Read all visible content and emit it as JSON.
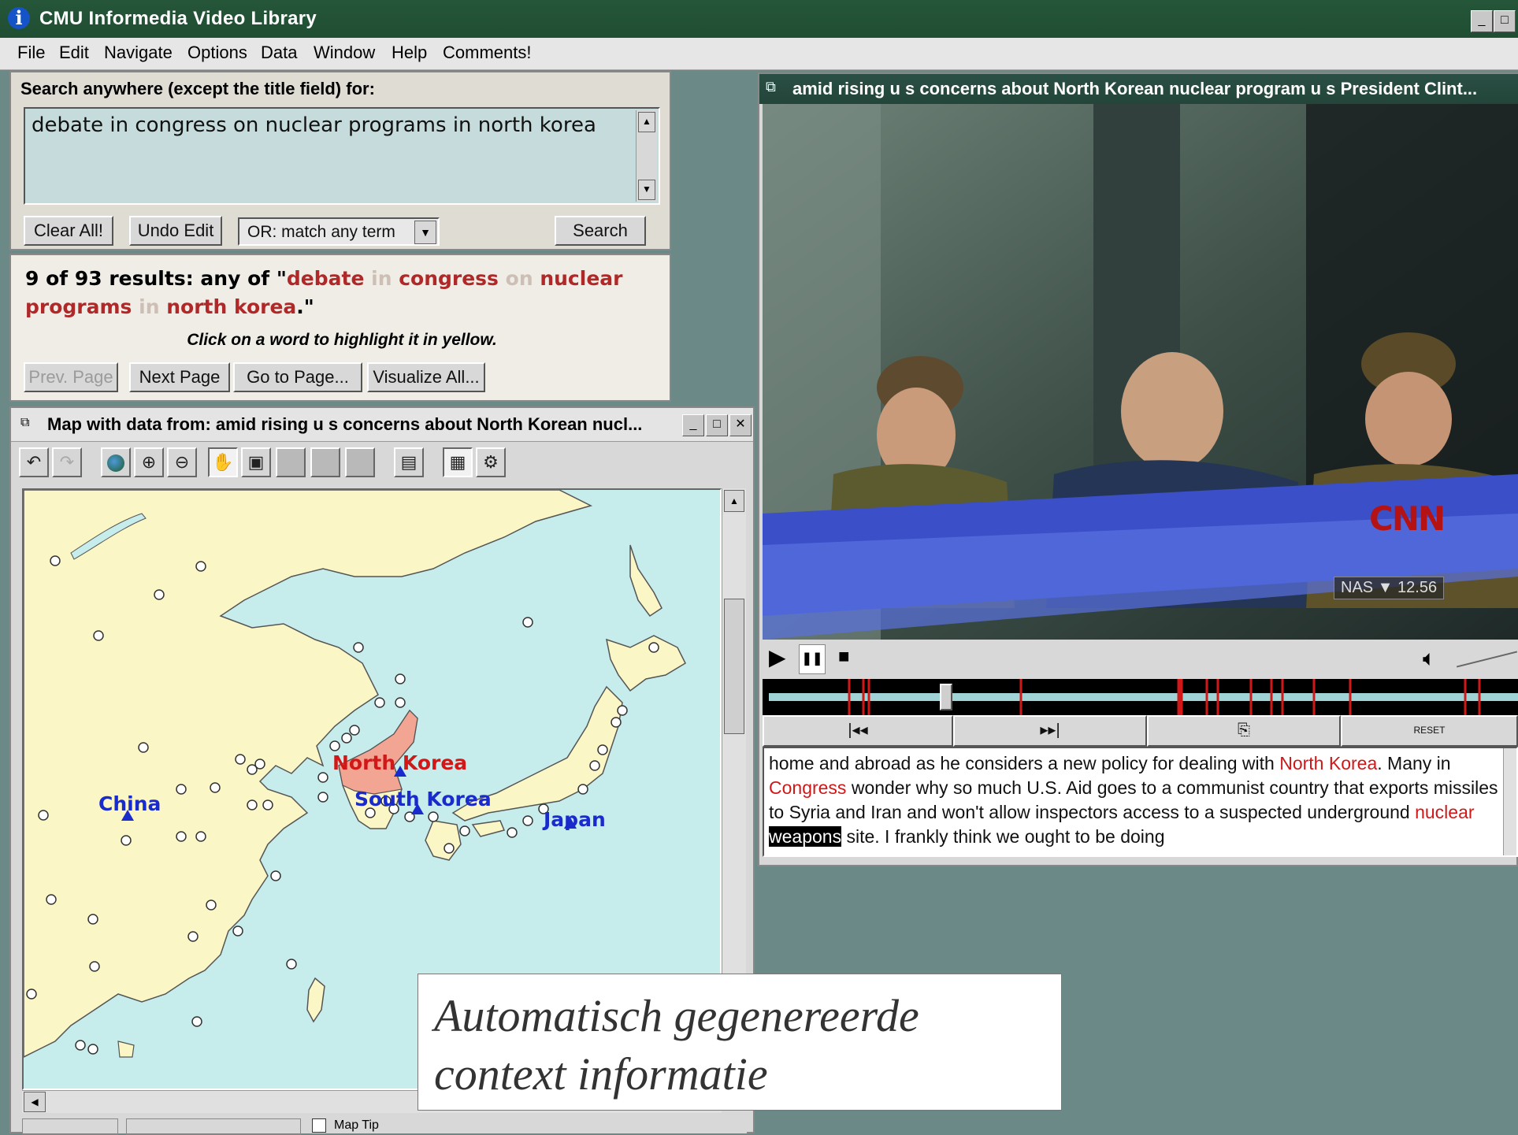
{
  "app": {
    "title": "CMU Informedia Video Library"
  },
  "menu": [
    "File",
    "Edit",
    "Navigate",
    "Options",
    "Data",
    "Window",
    "Help",
    "Comments!"
  ],
  "search": {
    "label": "Search anywhere (except the title field) for:",
    "query": "debate in congress on nuclear programs in north korea",
    "clear_label": "Clear All!",
    "undo_label": "Undo Edit",
    "match_mode": "OR:  match any term",
    "search_label": "Search"
  },
  "results": {
    "count_text": "9 of 93 results: any of",
    "quote_open": "\"",
    "quote_close": ".\"",
    "terms": [
      {
        "w": "debate",
        "s": "red"
      },
      {
        "w": "in",
        "s": "grey"
      },
      {
        "w": "congress",
        "s": "red"
      },
      {
        "w": "on",
        "s": "grey"
      },
      {
        "w": "nuclear",
        "s": "red"
      },
      {
        "w": "programs",
        "s": "red"
      },
      {
        "w": "in",
        "s": "grey"
      },
      {
        "w": "north",
        "s": "red"
      },
      {
        "w": "korea",
        "s": "red"
      }
    ],
    "hint": "Click on a word to highlight it in yellow.",
    "prev_label": "Prev. Page",
    "next_label": "Next Page",
    "goto_label": "Go to Page...",
    "visualize_label": "Visualize All..."
  },
  "map": {
    "title": "Map with data from:  amid rising u s concerns about North Korean nucl...",
    "labels": {
      "north_korea": "North Korea",
      "south_korea": "South Korea",
      "china": "China",
      "japan": "Japan"
    },
    "colors": {
      "water": "#c6ecec",
      "land": "#fbf6c5",
      "highlight": "#f2a592"
    },
    "toolbar_icons": [
      "undo-icon",
      "redo-icon",
      "globe-icon",
      "zoom-in-icon",
      "zoom-out-icon",
      "pan-hand-icon",
      "select-icon",
      "tool-6-icon",
      "tool-7-icon",
      "tool-8-icon",
      "layers-icon",
      "legend-icon",
      "settings-icon"
    ],
    "status": {
      "map_tip_label": "Map Tip"
    }
  },
  "video": {
    "title": "amid rising u s concerns about North Korean nuclear program u s President Clint...",
    "overlay_brand": "CNN",
    "overlay_ticker": "NAS ▼  12.56",
    "transport": {
      "play": "▶",
      "pause": "❚❚",
      "stop": "■",
      "rewind": "|◂◂",
      "forward": "▸▸|",
      "reset": "RESET"
    },
    "progress": 0.23
  },
  "transcript": [
    {
      "t": "home and abroad as he considers a new policy for dealing with "
    },
    {
      "t": "North Korea",
      "s": "red"
    },
    {
      "t": ". Many in "
    },
    {
      "t": "Congress",
      "s": "red"
    },
    {
      "t": " wonder why so much U.S. Aid goes to a communist country that exports missiles to Syria and Iran and won't allow inspectors access to a suspected underground "
    },
    {
      "t": "nuclear",
      "s": "red"
    },
    {
      "t": " "
    },
    {
      "t": "weapons",
      "s": "inv"
    },
    {
      "t": " site. I frankly think we ought to be doing"
    }
  ],
  "caption": {
    "line1": "Automatisch gegenereerde",
    "line2": "context informatie"
  }
}
